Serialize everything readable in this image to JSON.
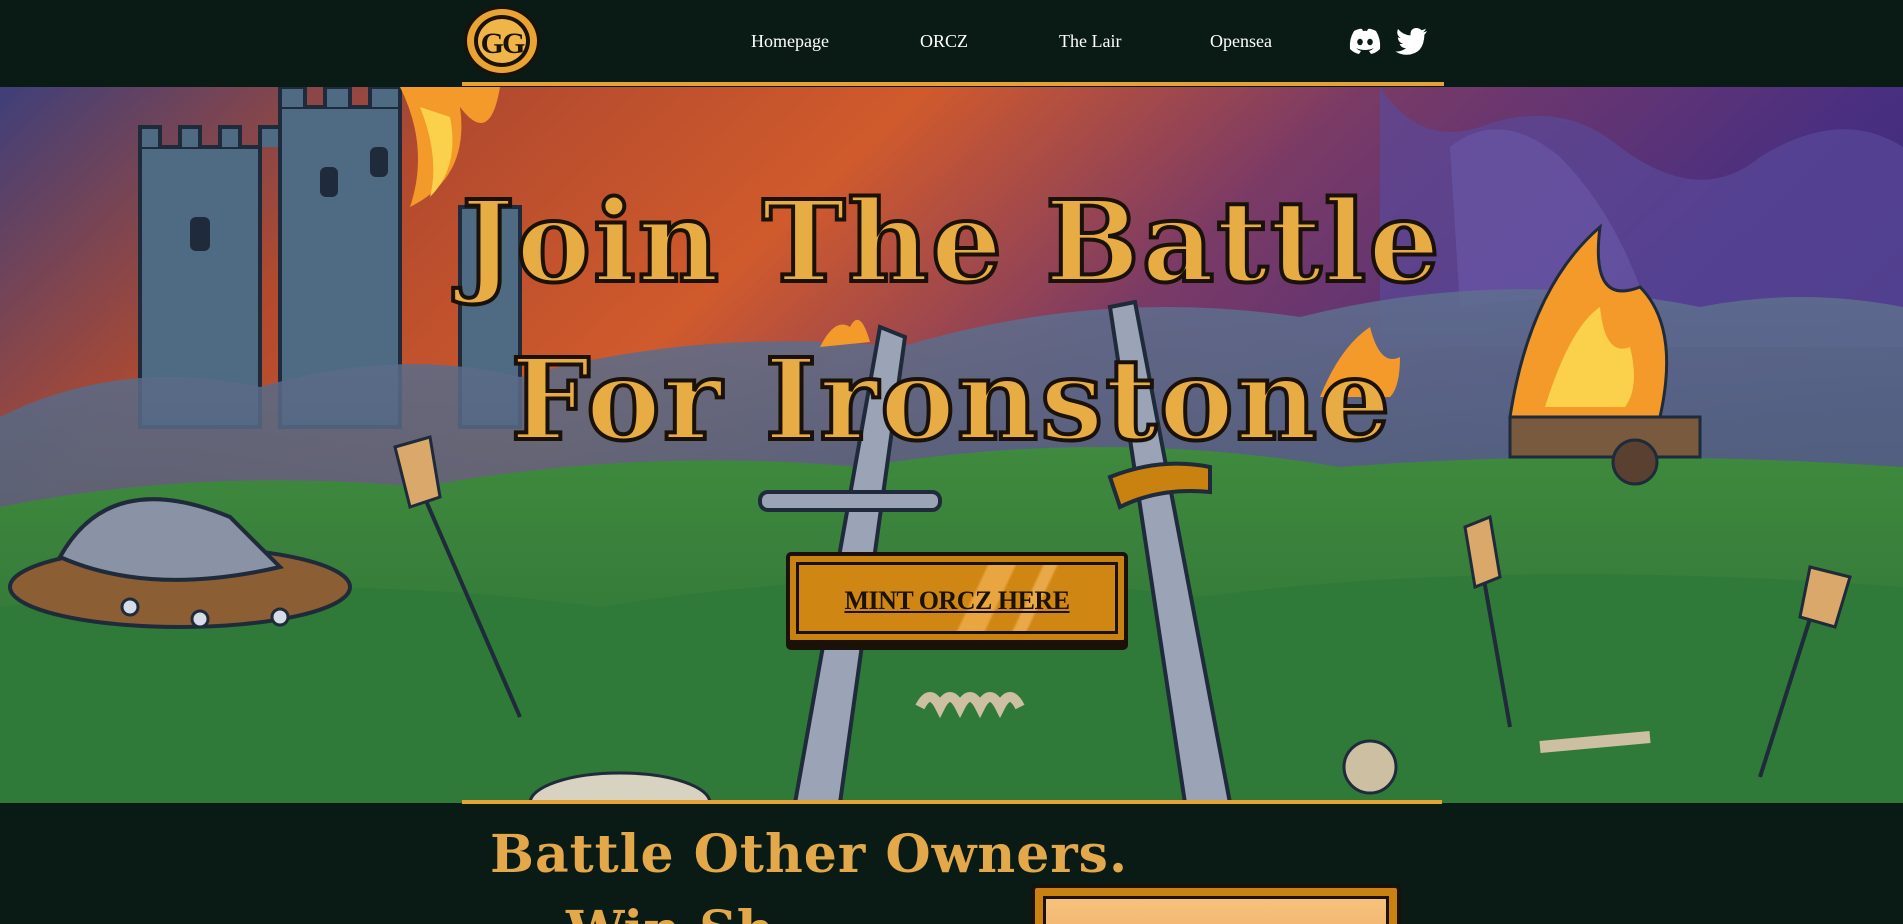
{
  "header": {
    "logo_text": "GG",
    "nav": [
      {
        "label": "Homepage"
      },
      {
        "label": "ORCZ"
      },
      {
        "label": "The Lair"
      },
      {
        "label": "Opensea"
      }
    ],
    "social": [
      {
        "icon": "discord-icon"
      },
      {
        "icon": "twitter-icon"
      }
    ]
  },
  "hero": {
    "title_line1": "Join The Battle",
    "title_line2": "For Ironstone",
    "cta_label": "MINT ORCZ HERE"
  },
  "section": {
    "title_line1": "Battle Other Owners.",
    "title_line2": "Win Sh..."
  },
  "colors": {
    "background": "#0a1a14",
    "accent": "#e3a336",
    "title_gold": "#e8ac44",
    "button": "#c9820f"
  }
}
